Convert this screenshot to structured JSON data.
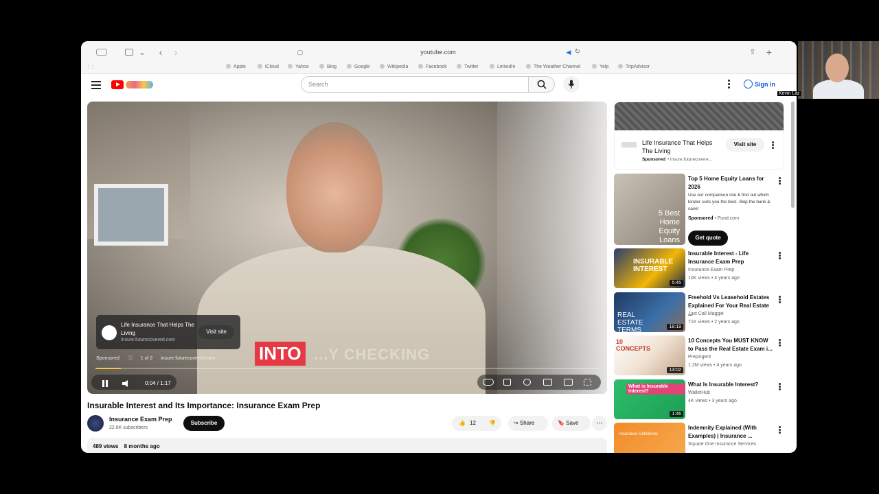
{
  "browser": {
    "url": "youtube.com",
    "favorites": [
      "Apple",
      "iCloud",
      "Yahoo",
      "Bing",
      "Google",
      "Wikipedia",
      "Facebook",
      "Twitter",
      "LinkedIn",
      "The Weather Channel",
      "Yelp",
      "TripAdvisor"
    ]
  },
  "header": {
    "search_placeholder": "Search",
    "signin_label": "Sign in"
  },
  "video": {
    "overlay_main": "INTO",
    "overlay_rest": "...Y CHECKING",
    "ad_title": "Life Insurance That Helps The Living",
    "ad_domain": "insure.futurecovered.com",
    "ad_visit": "Visit site",
    "ad_sponsored": "Sponsored",
    "ad_count": "1 of 2",
    "ad_domain2": "insure.futurecovered.com",
    "time": "0:04 / 1:17",
    "progress": 0.05
  },
  "info": {
    "title": "Insurable Interest and Its Importance: Insurance Exam Prep",
    "channel": "Insurance Exam Prep",
    "subscribers": "22.6K subscribers",
    "subscribe_label": "Subscribe",
    "likes": "12",
    "share_label": "Share",
    "save_label": "Save",
    "views": "489 views",
    "age": "8 months ago"
  },
  "sidebar": {
    "ad": {
      "title": "Life Insurance That Helps The Living",
      "sponsored": "Sponsored",
      "domain": "insure.futurecovere...",
      "visit": "Visit site"
    },
    "sponsored_rec": {
      "title": "Top 5 Home Equity Loans for 2026",
      "thumb_text": "5 Best Home Equity Loans",
      "desc": "Use our comparison site & find out which lender suits you the best. Skip the bank & save!",
      "sponsored": "Sponsored",
      "domain": "Fund.com",
      "cta": "Get quote"
    },
    "recs": [
      {
        "title": "Insurable Interest - Life Insurance Exam Prep",
        "channel": "Insurance Exam Prep",
        "meta": "10K views • 4 years ago",
        "duration": "5:45",
        "thumb_text": "INSURABLE INTEREST"
      },
      {
        "title": "Freehold Vs Leasehold Estates Explained For Your Real Estate ...",
        "channel": "Just Call Maggie",
        "meta": "71K views • 2 years ago",
        "duration": "18:19",
        "thumb_text": "REAL ESTATE TERMS"
      },
      {
        "title": "10 Concepts You MUST KNOW to Pass the Real Estate Exam i...",
        "channel": "PrepAgent",
        "meta": "1.2M views • 4 years ago",
        "duration": "13:02",
        "thumb_text": "10 CONCEPTS"
      },
      {
        "title": "What Is Insurable Interest?",
        "channel": "WalletHub",
        "meta": "4K views • 3 years ago",
        "duration": "1:46",
        "thumb_text": "What is Insurable Interest?"
      },
      {
        "title": "Indemnity Explained (With Examples) | Insurance ...",
        "channel": "Square One Insurance Services",
        "meta": "",
        "duration": "",
        "thumb_text": "Insurance Definitions"
      }
    ]
  },
  "webcam": {
    "label": "Kevin Litz"
  }
}
